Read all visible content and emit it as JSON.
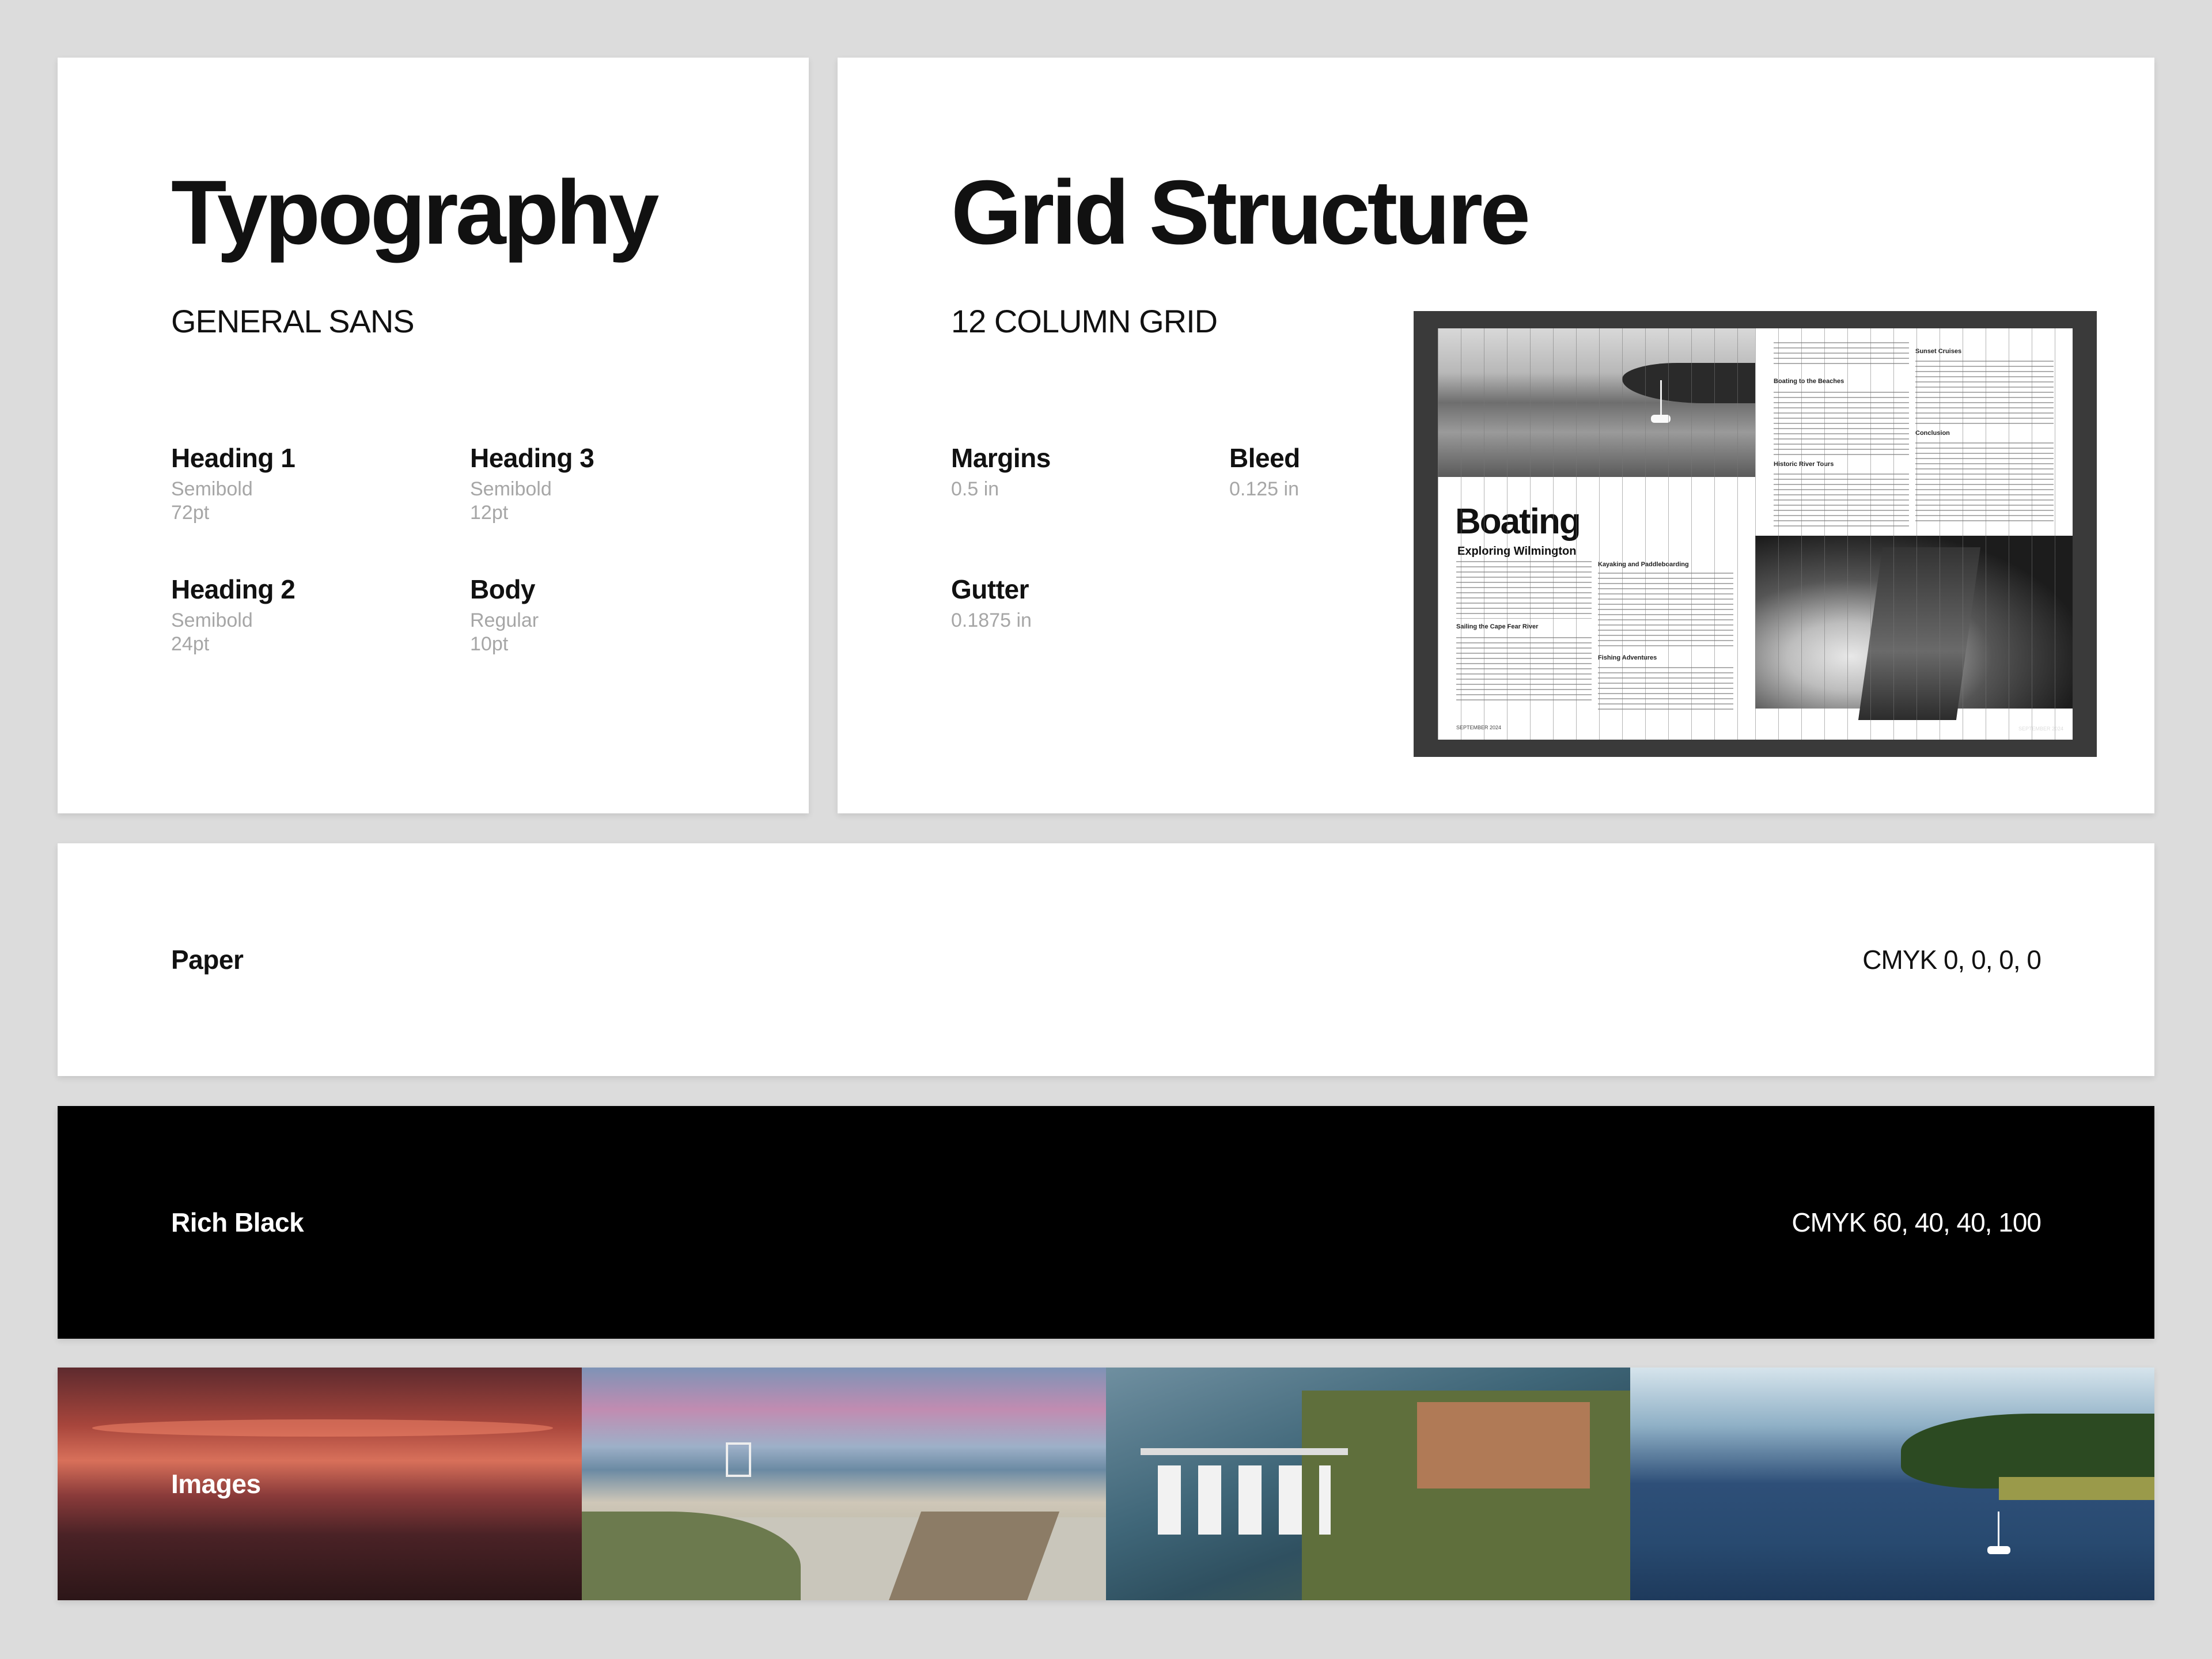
{
  "typography": {
    "title": "Typography",
    "font_name": "GENERAL SANS",
    "specs": [
      {
        "name": "Heading 1",
        "weight": "Semibold",
        "size": "72pt"
      },
      {
        "name": "Heading 3",
        "weight": "Semibold",
        "size": "12pt"
      },
      {
        "name": "Heading 2",
        "weight": "Semibold",
        "size": "24pt"
      },
      {
        "name": "Body",
        "weight": "Regular",
        "size": "10pt"
      }
    ]
  },
  "grid": {
    "title": "Grid Structure",
    "subtitle": "12 COLUMN GRID",
    "specs": [
      {
        "name": "Margins",
        "value": "0.5 in"
      },
      {
        "name": "Bleed",
        "value": "0.125 in"
      },
      {
        "name": "Gutter",
        "value": "0.1875 in"
      }
    ],
    "mockup": {
      "title": "Boating",
      "subtitle": "Exploring Wilmington",
      "heads": [
        "Sailing the Cape Fear River",
        "Kayaking and Paddleboarding",
        "Fishing Adventures",
        "Boating to the Beaches",
        "Historic River Tours",
        "Sunset Cruises",
        "Conclusion"
      ],
      "folio_left": "SEPTEMBER 2024",
      "folio_right": "SEPTEMBER 2024"
    }
  },
  "colors": {
    "paper": {
      "label": "Paper",
      "value": "CMYK 0, 0, 0, 0",
      "hex": "#ffffff"
    },
    "rich_black": {
      "label": "Rich Black",
      "value": "CMYK 60, 40, 40, 100",
      "hex": "#000000"
    }
  },
  "images": {
    "label": "Images"
  }
}
